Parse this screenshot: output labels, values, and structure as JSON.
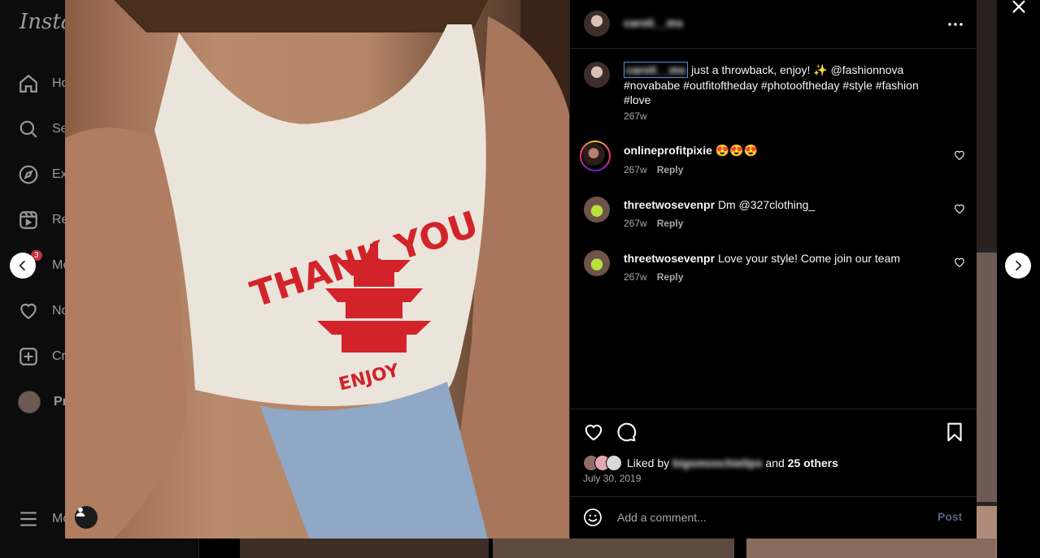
{
  "app": {
    "logo_text": "Instag",
    "nav": [
      {
        "label": "Ho",
        "icon": "home-icon"
      },
      {
        "label": "Se",
        "icon": "search-icon"
      },
      {
        "label": "Ex",
        "icon": "explore-icon"
      },
      {
        "label": "Re",
        "icon": "reels-icon"
      },
      {
        "label": "Me",
        "icon": "messages-icon",
        "badge": "3"
      },
      {
        "label": "No",
        "icon": "notifications-icon"
      },
      {
        "label": "Cr",
        "icon": "create-icon"
      },
      {
        "label": "Pr",
        "icon": "profile-avatar"
      }
    ],
    "more_label": "Mo"
  },
  "post": {
    "photo_text": [
      "THANK YOU",
      "ENJOY"
    ],
    "header": {
      "username": "caroli__ms",
      "more_icon": "more-options-icon"
    },
    "caption": {
      "username": "caroli__ms",
      "text": "just a throwback, enjoy! ✨ @fashionnova #novababe #outfitoftheday #photooftheday #style #fashion #love",
      "time": "267w"
    },
    "comments": [
      {
        "username": "onlineprofitpixie",
        "text": "😍😍😍",
        "time": "267w",
        "reply": "Reply"
      },
      {
        "username": "threetwosevenpr",
        "text": "Dm @327clothing_",
        "time": "267w",
        "reply": "Reply"
      },
      {
        "username": "threetwosevenpr",
        "text": "Love your style! Come join our team",
        "time": "267w",
        "reply": "Reply"
      }
    ],
    "likes": {
      "prefix": "Liked by",
      "user": "bigsmoochielips",
      "conjunction": "and",
      "others": "25 others"
    },
    "date": "July 30, 2019",
    "add_comment": {
      "placeholder": "Add a comment...",
      "post_label": "Post"
    }
  },
  "colors": {
    "background": "#000000",
    "text": "#f5f5f5",
    "secondary_text": "#a8a8a8",
    "divider": "#262626",
    "accent": "#0095f6"
  }
}
